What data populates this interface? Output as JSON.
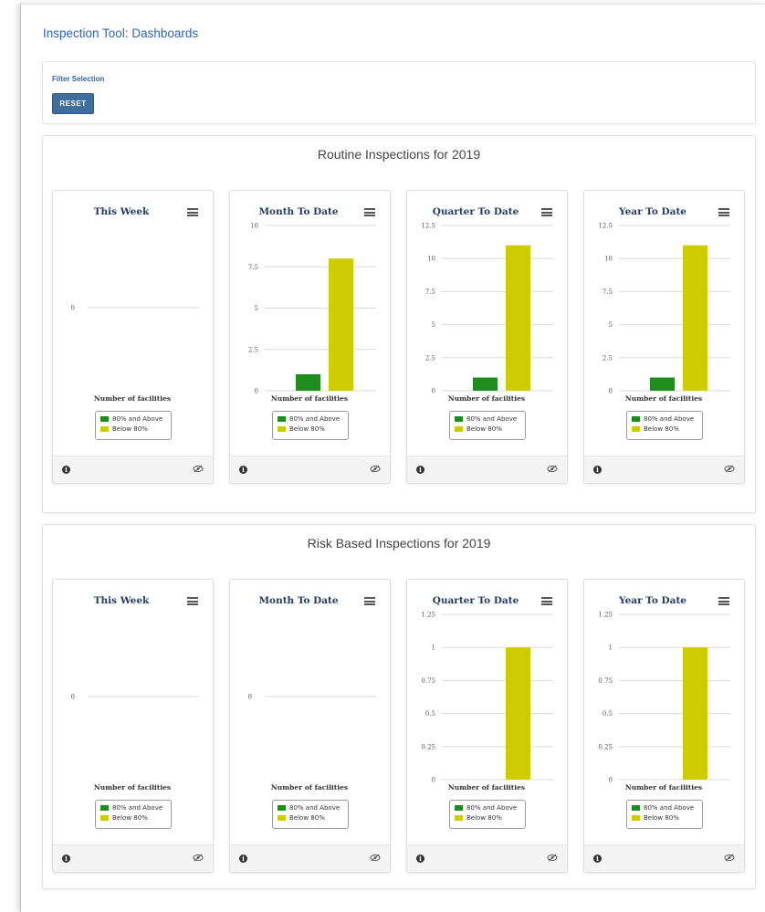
{
  "app": {
    "title": "Inspection Tool: Dashboards"
  },
  "filter": {
    "title": "Filter Selection",
    "reset_label": "RESET"
  },
  "colors": {
    "accent": "#2f63b5",
    "above": "#1e8c1e",
    "below": "#cccc00"
  },
  "icons": {
    "menu": "hamburger-menu-icon",
    "info": "info-icon",
    "visibility": "eye-slash-icon"
  },
  "sections": [
    {
      "title": "Routine Inspections for 2019",
      "cards": [
        {
          "title": "This Week",
          "xlabel": "Number of facilities",
          "chart_data": {
            "type": "bar",
            "categories": [
              "Number of facilities"
            ],
            "ticks": [
              "0"
            ],
            "ylim": [
              0,
              0
            ],
            "series": [
              {
                "name": "80% and Above",
                "values": [
                  0
                ]
              },
              {
                "name": "Below 80%",
                "values": [
                  0
                ]
              }
            ]
          }
        },
        {
          "title": "Month To Date",
          "xlabel": "Number of facilities",
          "chart_data": {
            "type": "bar",
            "categories": [
              "Number of facilities"
            ],
            "ticks": [
              "0",
              "2.5",
              "5",
              "7.5",
              "10"
            ],
            "ylim": [
              0,
              10
            ],
            "series": [
              {
                "name": "80% and Above",
                "values": [
                  1
                ]
              },
              {
                "name": "Below 80%",
                "values": [
                  8
                ]
              }
            ]
          }
        },
        {
          "title": "Quarter To Date",
          "xlabel": "Number of facilities",
          "chart_data": {
            "type": "bar",
            "categories": [
              "Number of facilities"
            ],
            "ticks": [
              "0",
              "2.5",
              "5",
              "7.5",
              "10",
              "12.5"
            ],
            "ylim": [
              0,
              12.5
            ],
            "series": [
              {
                "name": "80% and Above",
                "values": [
                  1
                ]
              },
              {
                "name": "Below 80%",
                "values": [
                  11
                ]
              }
            ]
          }
        },
        {
          "title": "Year To Date",
          "xlabel": "Number of facilities",
          "chart_data": {
            "type": "bar",
            "categories": [
              "Number of facilities"
            ],
            "ticks": [
              "0",
              "2.5",
              "5",
              "7.5",
              "10",
              "12.5"
            ],
            "ylim": [
              0,
              12.5
            ],
            "series": [
              {
                "name": "80% and Above",
                "values": [
                  1
                ]
              },
              {
                "name": "Below 80%",
                "values": [
                  11
                ]
              }
            ]
          }
        }
      ]
    },
    {
      "title": "Risk Based Inspections for 2019",
      "cards": [
        {
          "title": "This Week",
          "xlabel": "Number of facilities",
          "chart_data": {
            "type": "bar",
            "categories": [
              "Number of facilities"
            ],
            "ticks": [
              "0"
            ],
            "ylim": [
              0,
              0
            ],
            "series": [
              {
                "name": "80% and Above",
                "values": [
                  0
                ]
              },
              {
                "name": "Below 80%",
                "values": [
                  0
                ]
              }
            ]
          }
        },
        {
          "title": "Month To Date",
          "xlabel": "Number of facilities",
          "chart_data": {
            "type": "bar",
            "categories": [
              "Number of facilities"
            ],
            "ticks": [
              "0"
            ],
            "ylim": [
              0,
              0
            ],
            "series": [
              {
                "name": "80% and Above",
                "values": [
                  0
                ]
              },
              {
                "name": "Below 80%",
                "values": [
                  0
                ]
              }
            ]
          }
        },
        {
          "title": "Quarter To Date",
          "xlabel": "Number of facilities",
          "chart_data": {
            "type": "bar",
            "categories": [
              "Number of facilities"
            ],
            "ticks": [
              "0",
              "0.25",
              "0.5",
              "0.75",
              "1",
              "1.25"
            ],
            "ylim": [
              0,
              1.25
            ],
            "series": [
              {
                "name": "80% and Above",
                "values": [
                  0
                ]
              },
              {
                "name": "Below 80%",
                "values": [
                  1
                ]
              }
            ]
          }
        },
        {
          "title": "Year To Date",
          "xlabel": "Number of facilities",
          "chart_data": {
            "type": "bar",
            "categories": [
              "Number of facilities"
            ],
            "ticks": [
              "0",
              "0.25",
              "0.5",
              "0.75",
              "1",
              "1.25"
            ],
            "ylim": [
              0,
              1.25
            ],
            "series": [
              {
                "name": "80% and Above",
                "values": [
                  0
                ]
              },
              {
                "name": "Below 80%",
                "values": [
                  1
                ]
              }
            ]
          }
        }
      ]
    }
  ]
}
